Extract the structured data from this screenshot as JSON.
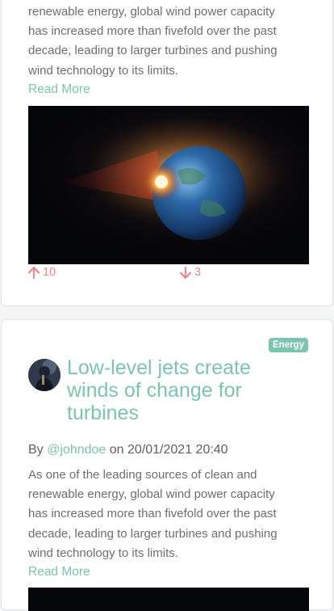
{
  "posts": [
    {
      "excerpt_lines": [
        "renewable energy, global wind power capacity",
        "has increased more than fivefold over the past",
        "decade, leading to larger turbines and pushing",
        "wind technology to its limits."
      ],
      "read_more": "Read More",
      "upvotes": "10",
      "downvotes": "3"
    },
    {
      "tag": "Energy",
      "title": "Low-level jets create winds of change for turbines",
      "by": "By",
      "author": "@johndoe",
      "on": "on",
      "date": "20/01/2021 20:40",
      "excerpt_lines": [
        "As one of the leading sources of clean and",
        "renewable energy, global wind power capacity",
        "has increased more than fivefold over the past",
        "decade, leading to larger turbines and pushing",
        "wind technology to its limits."
      ],
      "read_more": "Read More"
    }
  ],
  "colors": {
    "accent": "#7bc4b0",
    "vote": "#ea8a8a",
    "body_text": "#6e6e6e"
  },
  "icons": {
    "upvote": "arrow-up-icon",
    "downvote": "arrow-down-icon",
    "hero": "planet-explosion-image"
  }
}
